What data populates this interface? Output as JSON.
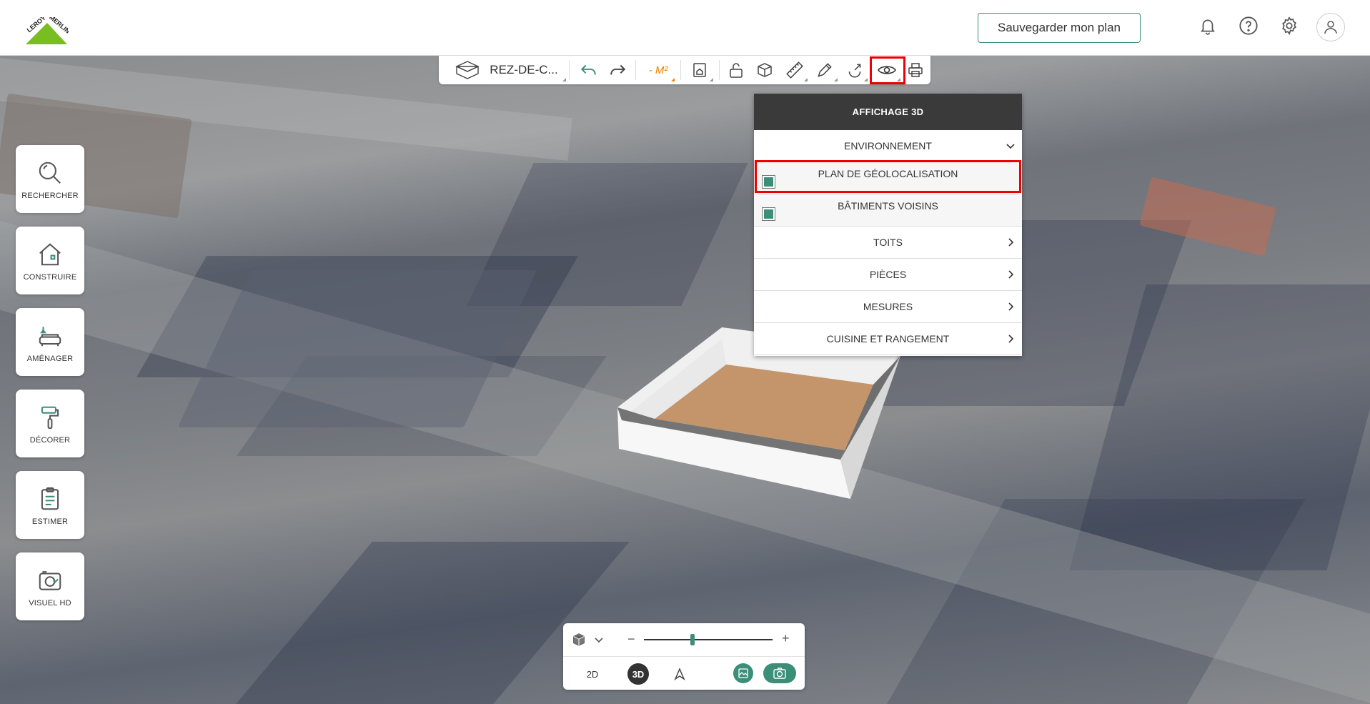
{
  "header": {
    "logo_text": "LEROY MERLIN",
    "save_label": "Sauvegarder mon plan",
    "icons": [
      "bell-icon",
      "help-icon",
      "gear-icon",
      "user-icon"
    ]
  },
  "sidebar": {
    "items": [
      {
        "label": "RECHERCHER",
        "icon": "search-icon"
      },
      {
        "label": "CONSTRUIRE",
        "icon": "house-icon"
      },
      {
        "label": "AMÉNAGER",
        "icon": "sofa-icon"
      },
      {
        "label": "DÉCORER",
        "icon": "paint-roller-icon"
      },
      {
        "label": "ESTIMER",
        "icon": "clipboard-icon"
      },
      {
        "label": "VISUEL HD",
        "icon": "camera-icon"
      }
    ]
  },
  "toolbar": {
    "level": "REZ-DE-C...",
    "m2_label": "- M²",
    "icons": [
      "floor-plan-icon",
      "undo-icon",
      "redo-icon",
      "room-icon",
      "unlock-icon",
      "cube-icon",
      "ruler-icon",
      "pencil-icon",
      "magnet-icon",
      "eye-icon",
      "print-icon"
    ]
  },
  "panel": {
    "title": "AFFICHAGE 3D",
    "section": "ENVIRONNEMENT",
    "options": [
      {
        "label": "PLAN DE GÉOLOCALISATION",
        "checked": true
      },
      {
        "label": "BÂTIMENTS VOISINS",
        "checked": true
      }
    ],
    "rows": [
      "TOITS",
      "PIÈCES",
      "MESURES",
      "CUISINE ET RANGEMENT"
    ]
  },
  "bottom": {
    "zoom_minus": "−",
    "zoom_plus": "+",
    "zoom_level": 0.38,
    "view_2d": "2D",
    "view_3d": "3D"
  },
  "colors": {
    "accent": "#3b8f79",
    "highlight": "#e00000",
    "m2": "#f08000"
  }
}
